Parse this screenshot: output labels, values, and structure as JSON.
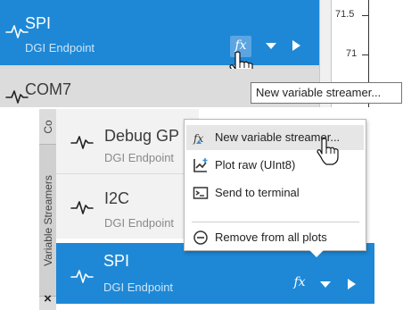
{
  "top": {
    "endpoint": {
      "title": "SPI",
      "subtitle": "DGI Endpoint"
    },
    "next_endpoint": {
      "title": "COM7"
    },
    "plot_ticks": [
      "71.5",
      "71"
    ],
    "tooltip": "New variable streamer...",
    "fx_glyph": "fx"
  },
  "bottom": {
    "vertical_tabs": [
      "Co",
      "Variable Streamers",
      "×"
    ],
    "endpoints": [
      {
        "title": "Debug GP",
        "subtitle": "DGI Endpoint"
      },
      {
        "title": "I2C",
        "subtitle": "DGI Endpoint"
      },
      {
        "title": "SPI",
        "subtitle": "DGI Endpoint"
      }
    ],
    "context_menu": [
      {
        "label": "New variable streamer...",
        "icon": "new-streamer-icon"
      },
      {
        "label": "Plot raw (UInt8)",
        "icon": "plot-raw-icon"
      },
      {
        "label": "Send to terminal",
        "icon": "terminal-icon"
      },
      {
        "label": "Remove from all plots",
        "icon": "remove-circle-icon"
      }
    ],
    "fx_glyph": "fx"
  },
  "colors": {
    "accent": "#1e88d6",
    "fx_button": "#5aa5e2",
    "selected_menu": "#e6e6e6"
  }
}
